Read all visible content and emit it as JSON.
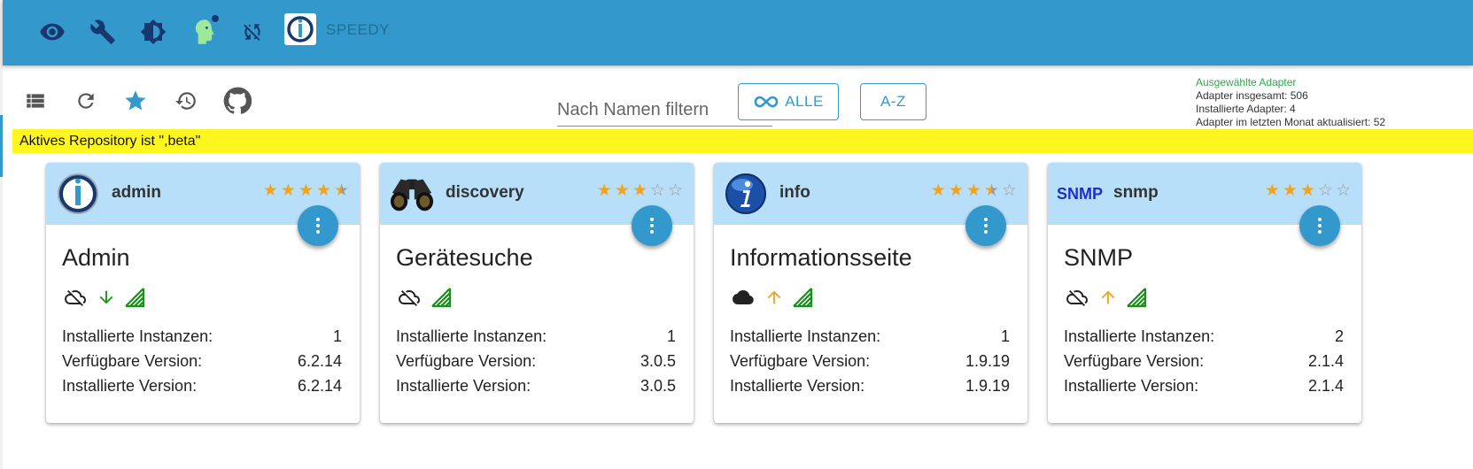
{
  "header": {
    "brand": "SPEEDY",
    "icons": [
      "eye-icon",
      "wrench-icon",
      "brightness-icon",
      "head-icon",
      "sync-disabled-icon"
    ]
  },
  "toolbar": {
    "icons": [
      "list-icon",
      "refresh-icon",
      "star-icon",
      "history-icon",
      "github-icon"
    ],
    "filter_placeholder": "Nach Namen filtern",
    "all_button": "ALLE",
    "sort_button": "A-Z"
  },
  "stats": {
    "selected": "Ausgewählte Adapter",
    "total": "Adapter insgesamt: 506",
    "installed": "Installierte Adapter: 4",
    "updated": "Adapter im letzten Monat aktualisiert: 52"
  },
  "repo_banner": "Aktives Repository ist \",beta\"",
  "labels": {
    "instances": "Installierte Instanzen:",
    "available": "Verfügbare Version:",
    "installed": "Installierte Version:"
  },
  "cards": [
    {
      "name": "admin",
      "title": "Admin",
      "rating": 4.5,
      "cloud": "cloud-off-icon",
      "arrow": "arrow-down-icon",
      "arrow_color": "#1a8f1a",
      "instances": "1",
      "available": "6.2.14",
      "installed": "6.2.14"
    },
    {
      "name": "discovery",
      "title": "Gerätesuche",
      "rating": 3,
      "cloud": "cloud-off-icon",
      "arrow": "",
      "arrow_color": "",
      "instances": "1",
      "available": "3.0.5",
      "installed": "3.0.5"
    },
    {
      "name": "info",
      "title": "Informationsseite",
      "rating": 3.5,
      "cloud": "cloud-icon",
      "arrow": "arrow-up-icon",
      "arrow_color": "#f2a21b",
      "instances": "1",
      "available": "1.9.19",
      "installed": "1.9.19"
    },
    {
      "name": "snmp",
      "title": "SNMP",
      "icon_text": "SNMP",
      "rating": 3,
      "cloud": "cloud-off-icon",
      "arrow": "arrow-up-icon",
      "arrow_color": "#f2a21b",
      "instances": "2",
      "available": "2.1.4",
      "installed": "2.1.4"
    }
  ],
  "colors": {
    "primary": "#3399cc",
    "card_head": "#b8dff9",
    "star": "#f2a21b",
    "banner": "#fff51f",
    "signal": "#1a8f1a"
  }
}
